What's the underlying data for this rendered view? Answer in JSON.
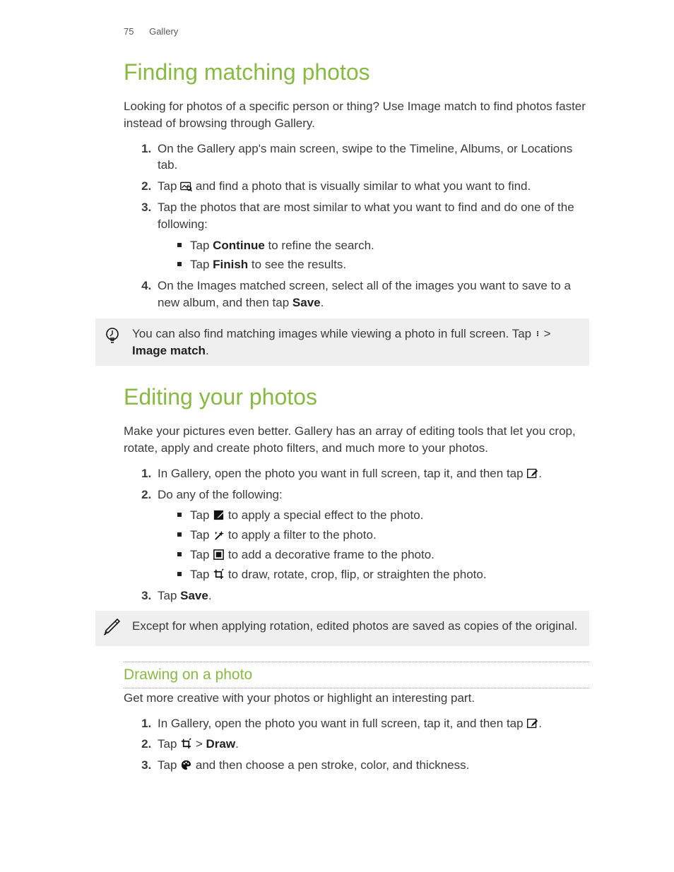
{
  "runhead": {
    "page": "75",
    "section": "Gallery"
  },
  "s1": {
    "title": "Finding matching photos",
    "intro": "Looking for photos of a specific person or thing? Use Image match to find photos faster instead of browsing through Gallery.",
    "step1": "On the Gallery app's main screen, swipe to the Timeline, Albums, or Locations tab.",
    "step2_a": "Tap ",
    "step2_b": " and find a photo that is visually similar to what you want to find.",
    "step3": "Tap the photos that are most similar to what you want to find and do one of the following:",
    "step3_sub1_a": "Tap ",
    "step3_sub1_bold": "Continue",
    "step3_sub1_b": " to refine the search.",
    "step3_sub2_a": "Tap ",
    "step3_sub2_bold": "Finish",
    "step3_sub2_b": " to see the results.",
    "step4_a": "On the Images matched screen, select all of the images you want to save to a new album, and then tap ",
    "step4_bold": "Save",
    "step4_b": ".",
    "tip_a": "You can also find matching images while viewing a photo in full screen. Tap ",
    "tip_b": " > ",
    "tip_bold": "Image match",
    "tip_c": "."
  },
  "s2": {
    "title": "Editing your photos",
    "intro": "Make your pictures even better. Gallery has an array of editing tools that let you crop, rotate, apply and create photo filters, and much more to your photos.",
    "step1_a": "In Gallery, open the photo you want in full screen, tap it, and then tap ",
    "step1_b": ".",
    "step2": "Do any of the following:",
    "step2_sub1_a": "Tap ",
    "step2_sub1_b": " to apply a special effect to the photo.",
    "step2_sub2_a": "Tap ",
    "step2_sub2_b": " to apply a filter to the photo.",
    "step2_sub3_a": "Tap ",
    "step2_sub3_b": " to add a decorative frame to the photo.",
    "step2_sub4_a": "Tap ",
    "step2_sub4_b": " to draw, rotate, crop, flip, or straighten the photo.",
    "step3_a": "Tap ",
    "step3_bold": "Save",
    "step3_b": ".",
    "note": "Except for when applying rotation, edited photos are saved as copies of the original."
  },
  "s3": {
    "title": "Drawing on a photo",
    "intro": "Get more creative with your photos or highlight an interesting part.",
    "step1_a": "In Gallery, open the photo you want in full screen, tap it, and then tap ",
    "step1_b": ".",
    "step2_a": "Tap ",
    "step2_b": " > ",
    "step2_bold": "Draw",
    "step2_c": ".",
    "step3_a": "Tap ",
    "step3_b": " and then choose a pen stroke, color, and thickness."
  },
  "icons": {
    "image_search": "image-search-icon",
    "overflow": "overflow-menu-icon",
    "edit": "edit-photo-icon",
    "effect": "effect-icon",
    "filter": "filter-wand-icon",
    "frame": "frame-icon",
    "crop": "crop-icon",
    "palette": "palette-icon",
    "lightbulb": "tip-lightbulb-icon",
    "pencil": "note-pencil-icon"
  }
}
